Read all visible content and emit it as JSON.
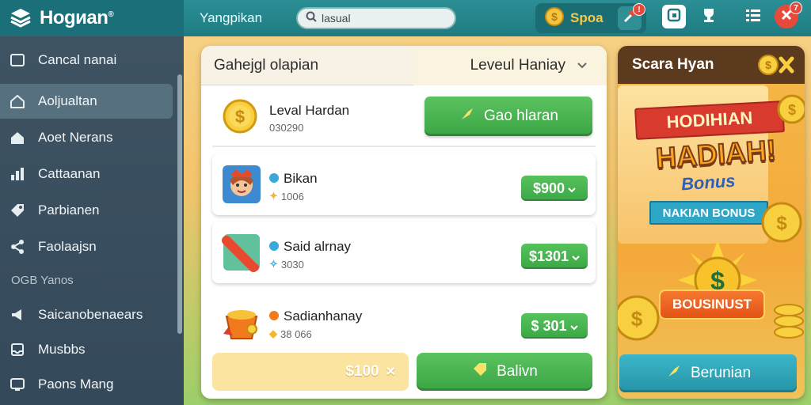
{
  "header": {
    "brand": "Hogиan",
    "brand_mark": "®",
    "title": "Yangpikan",
    "search_value": "lasual",
    "coin_label": "Spoa",
    "notification_count": "7"
  },
  "sidebar": {
    "items": [
      {
        "label": "Cancal nanai",
        "icon": "tv-icon"
      },
      {
        "label": "Aoljualtan",
        "icon": "home-icon"
      },
      {
        "label": "Aoet Nerans",
        "icon": "house-icon"
      },
      {
        "label": "Cattaanan",
        "icon": "chart-icon"
      },
      {
        "label": "Parbianen",
        "icon": "tag-icon"
      },
      {
        "label": "Faolaajsn",
        "icon": "share-icon"
      }
    ],
    "section_label": "OGB Yanos",
    "section_items": [
      {
        "label": "Saicanobenaears",
        "icon": "megaphone-icon"
      },
      {
        "label": "Musbbs",
        "icon": "inbox-icon"
      },
      {
        "label": "Paons Mang",
        "icon": "monitor-icon"
      }
    ]
  },
  "panel": {
    "title": "Gahejgl olapian",
    "dropdown_label": "Leveul Hаniay",
    "top_row": {
      "name": "Leval Hardan",
      "sub": "030290",
      "button": "Gao hlaran"
    },
    "rows": [
      {
        "name": "Bikan",
        "sub": "1006",
        "price": "$900",
        "dot_color": "#3aa8d8"
      },
      {
        "name": "Said alrnay",
        "sub": "3030",
        "price": "$1301",
        "dot_color": "#3aa8d8"
      },
      {
        "name": "Sadianhanay",
        "sub": "38 066",
        "price": "$ 301",
        "dot_color": "#f07a1c"
      }
    ],
    "footer_amount": "$100",
    "footer_button": "Balivn"
  },
  "promo": {
    "title": "Scara Hyan",
    "ribbon_red": "HODIHIAN",
    "headline": "HADIAH!",
    "bonus_word": "Bonus",
    "ribbon_blue": "NAKIAN BONUS",
    "bonus_pill": "BOUSINUST",
    "button": "Berunian"
  },
  "colors": {
    "teal": "#2b8f95",
    "sidebar": "#3e5362",
    "green": "#3ba545",
    "gold": "#f5c84a",
    "promo_orange": "#f4a93a"
  }
}
